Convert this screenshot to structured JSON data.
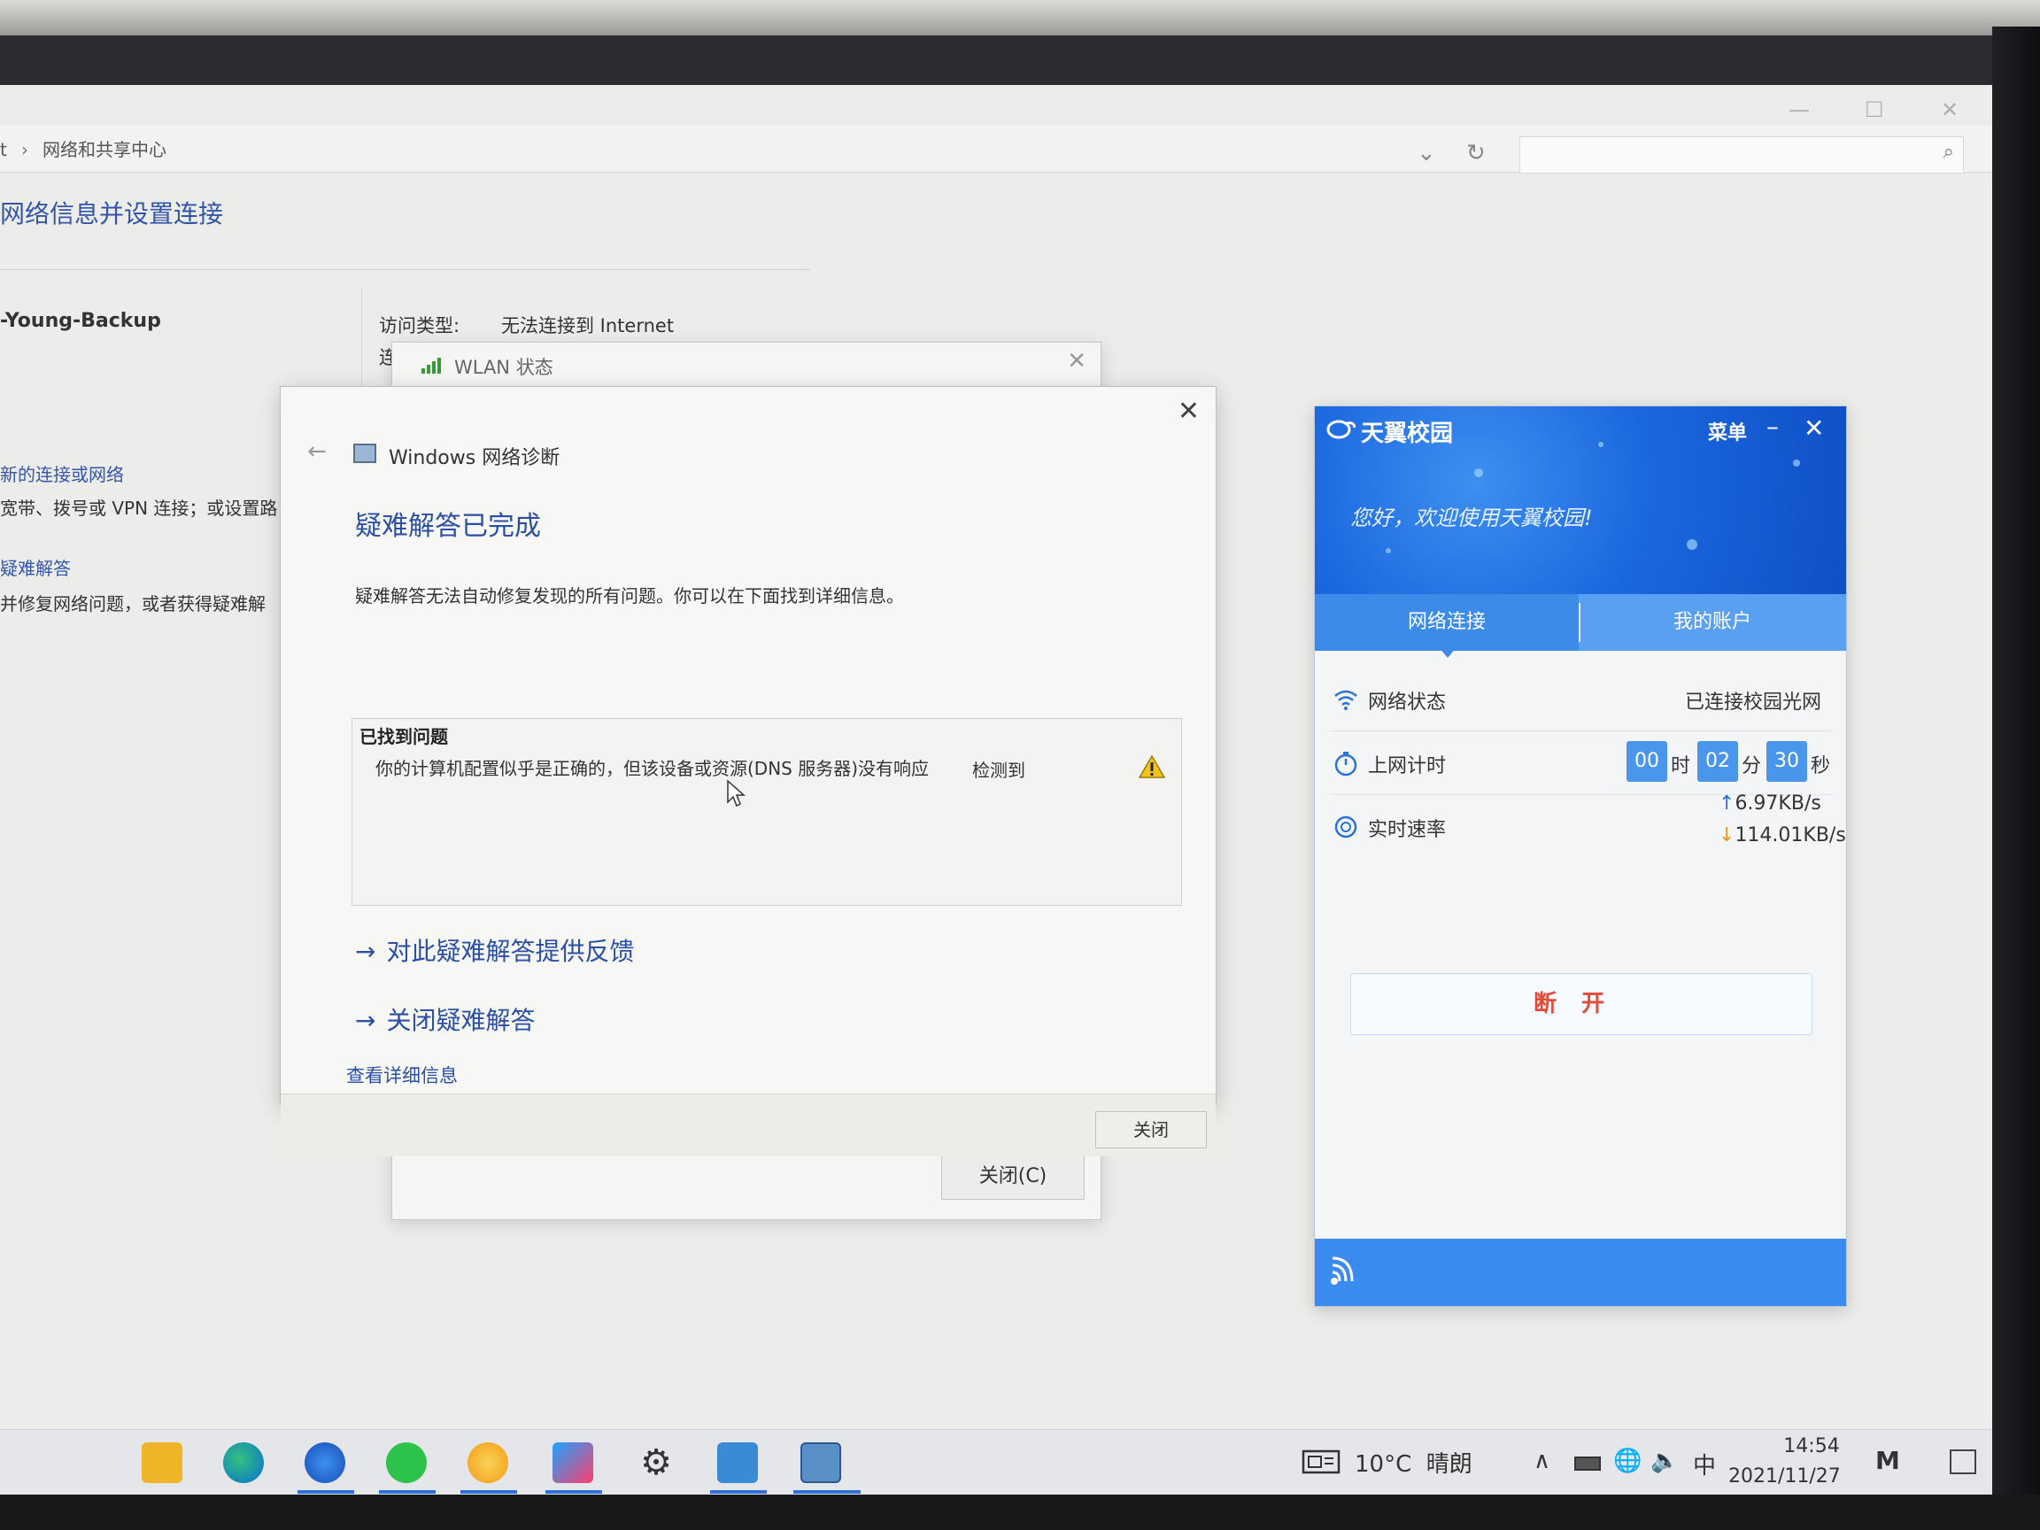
{
  "control_panel": {
    "breadcrumb_lead": "t",
    "breadcrumb_sep": "›",
    "breadcrumb_current": "网络和共享中心",
    "title": "网络信息并设置连接",
    "network_name": "-Young-Backup",
    "access_type_label": "访问类型:",
    "access_type_value": "无法连接到 Internet",
    "connection_label": "连接",
    "link_new_connection": "新的连接或网络",
    "text_new_connection": "宽带、拨号或 VPN 连接；或设置路",
    "link_troubleshoot": "疑难解答",
    "text_troubleshoot": "并修复网络问题，或者获得疑难解"
  },
  "wlan_dialog": {
    "title": "WLAN 状态",
    "close_button": "关闭(C)"
  },
  "diagnostics": {
    "app_title": "Windows 网络诊断",
    "heading": "疑难解答已完成",
    "description": "疑难解答无法自动修复发现的所有问题。你可以在下面找到详细信息。",
    "problems_header": "已找到问题",
    "issue_text": "你的计算机配置似乎是正确的，但该设备或资源(DNS 服务器)没有响应",
    "issue_status": "检测到",
    "link_feedback": "对此疑难解答提供反馈",
    "link_close": "关闭疑难解答",
    "link_details": "查看详细信息",
    "close_button": "关闭"
  },
  "tianyi": {
    "app_name": "天翼校园",
    "menu": "菜单",
    "welcome": "您好，欢迎使用天翼校园!",
    "tab_connection": "网络连接",
    "tab_account": "我的账户",
    "status_label": "网络状态",
    "status_value": "已连接校园光网",
    "timer_label": "上网计时",
    "timer_hours": "00",
    "timer_hours_unit": "时",
    "timer_minutes": "02",
    "timer_minutes_unit": "分",
    "timer_seconds": "30",
    "timer_seconds_unit": "秒",
    "speed_label": "实时速率",
    "upload_speed": "6.97KB/s",
    "download_speed": "114.01KB/s",
    "disconnect_button": "断开"
  },
  "taskbar": {
    "temperature": "10°C",
    "weather": "晴朗",
    "ime": "中",
    "time": "14:54",
    "date": "2021/11/27"
  },
  "colors": {
    "link_blue": "#2a4fa5",
    "tianyi_blue": "#1b67df",
    "disconnect_red": "#e14b3a"
  }
}
